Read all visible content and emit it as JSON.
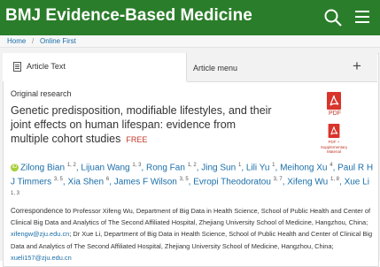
{
  "header": {
    "title": "BMJ Evidence-Based Medicine",
    "brand_color": "#2a7d2a",
    "search_icon": "search-icon",
    "menu_icon": "hamburger-menu-icon"
  },
  "breadcrumb": {
    "home": "Home",
    "separator": "/",
    "current": "Online First"
  },
  "tabs": {
    "article_text": "Article Text",
    "article_menu": "Article menu",
    "expand": "+"
  },
  "article": {
    "section": "Original research",
    "title": "Genetic predisposition, modifiable lifestyles, and their joint effects on human lifespan: evidence from multiple cohort studies",
    "badge": "FREE",
    "pdf_label": "PDF",
    "pdf_supp_label": "PDF + Supplementary Material"
  },
  "authors": [
    {
      "name": "Zilong Bian",
      "aff": "1, 2",
      "orcid": true
    },
    {
      "name": "Lijuan Wang",
      "aff": "1, 3"
    },
    {
      "name": "Rong Fan",
      "aff": "1, 2"
    },
    {
      "name": "Jing Sun",
      "aff": "1"
    },
    {
      "name": "Lili Yu",
      "aff": "1"
    },
    {
      "name": "Meihong Xu",
      "aff": "4"
    },
    {
      "name": "Paul R H J Timmers",
      "aff": "3, 5"
    },
    {
      "name": "Xia Shen",
      "aff": "6"
    },
    {
      "name": "James F Wilson",
      "aff": "3, 5"
    },
    {
      "name": "Evropi Theodoratou",
      "aff": "3, 7"
    },
    {
      "name": "Xifeng Wu",
      "aff": "1, 8"
    },
    {
      "name": "Xue Li",
      "aff": "1, 3"
    }
  ],
  "correspondence": {
    "label": "Correspondence to",
    "text1": "Professor Xifeng Wu, Department of Big Data in Health Science, School of Public Health and Center of Clinical Big Data and Analytics of The Second Affiliated Hospital, Zhejiang University School of Medicine, Hangzhou, China;",
    "email1": "xifengw@zju.edu.cn",
    "text2": "; Dr Xue Li, Department of Big Data in Health Science, School of Public Health and Center of Clinical Big Data and Analytics of The Second Affiliated Hospital, Zhejiang University School of Medicine, Hangzhou, China;",
    "email2": "xueli157@zju.edu.cn"
  }
}
